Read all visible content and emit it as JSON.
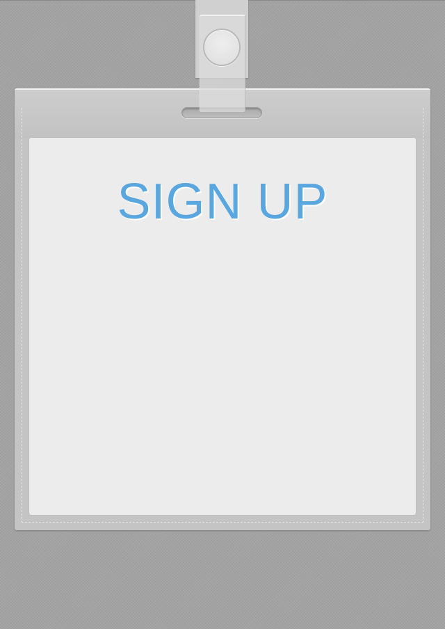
{
  "card": {
    "title": "SIGN UP"
  },
  "colors": {
    "background": "#a3a3a3",
    "holder": "#c4c4c4",
    "card": "#ececec",
    "title": "#5aa6de"
  },
  "icons": {
    "snap": "snap-button-icon",
    "slot": "badge-slot"
  }
}
